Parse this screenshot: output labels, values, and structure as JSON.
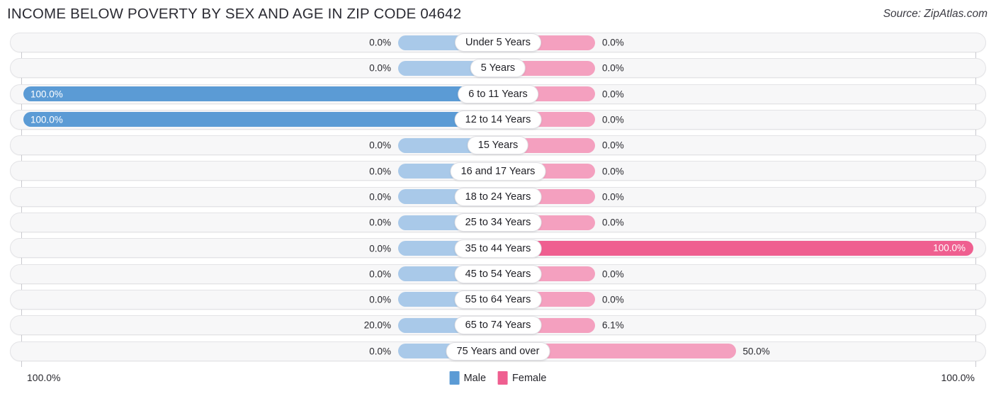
{
  "header": {
    "title": "INCOME BELOW POVERTY BY SEX AND AGE IN ZIP CODE 04642",
    "source": "Source: ZipAtlas.com"
  },
  "legend": {
    "male_label": "Male",
    "female_label": "Female",
    "male_color": "#5b9bd5",
    "female_color": "#ef5f90"
  },
  "axis": {
    "left_tick": "100.0%",
    "right_tick": "100.0%",
    "max": 100.0
  },
  "chart_data": {
    "type": "bar",
    "title": "INCOME BELOW POVERTY BY SEX AND AGE IN ZIP CODE 04642",
    "subtitle": "Source: ZipAtlas.com",
    "orientation": "horizontal-diverging",
    "xlabel": "",
    "ylabel": "",
    "xlim": [
      100.0,
      100.0
    ],
    "grid": false,
    "legend_position": "bottom-center",
    "categories": [
      "Under 5 Years",
      "5 Years",
      "6 to 11 Years",
      "12 to 14 Years",
      "15 Years",
      "16 and 17 Years",
      "18 to 24 Years",
      "25 to 34 Years",
      "35 to 44 Years",
      "45 to 54 Years",
      "55 to 64 Years",
      "65 to 74 Years",
      "75 Years and over"
    ],
    "series": [
      {
        "name": "Male",
        "color": "#5b9bd5",
        "values": [
          0.0,
          0.0,
          100.0,
          100.0,
          0.0,
          0.0,
          0.0,
          0.0,
          0.0,
          0.0,
          0.0,
          20.0,
          0.0
        ],
        "labels": [
          "0.0%",
          "0.0%",
          "100.0%",
          "100.0%",
          "0.0%",
          "0.0%",
          "0.0%",
          "0.0%",
          "0.0%",
          "0.0%",
          "0.0%",
          "20.0%",
          "0.0%"
        ]
      },
      {
        "name": "Female",
        "color": "#ef5f90",
        "values": [
          0.0,
          0.0,
          0.0,
          0.0,
          0.0,
          0.0,
          0.0,
          0.0,
          100.0,
          0.0,
          0.0,
          6.1,
          50.0
        ],
        "labels": [
          "0.0%",
          "0.0%",
          "0.0%",
          "0.0%",
          "0.0%",
          "0.0%",
          "0.0%",
          "0.0%",
          "100.0%",
          "0.0%",
          "0.0%",
          "6.1%",
          "50.0%"
        ]
      }
    ]
  }
}
